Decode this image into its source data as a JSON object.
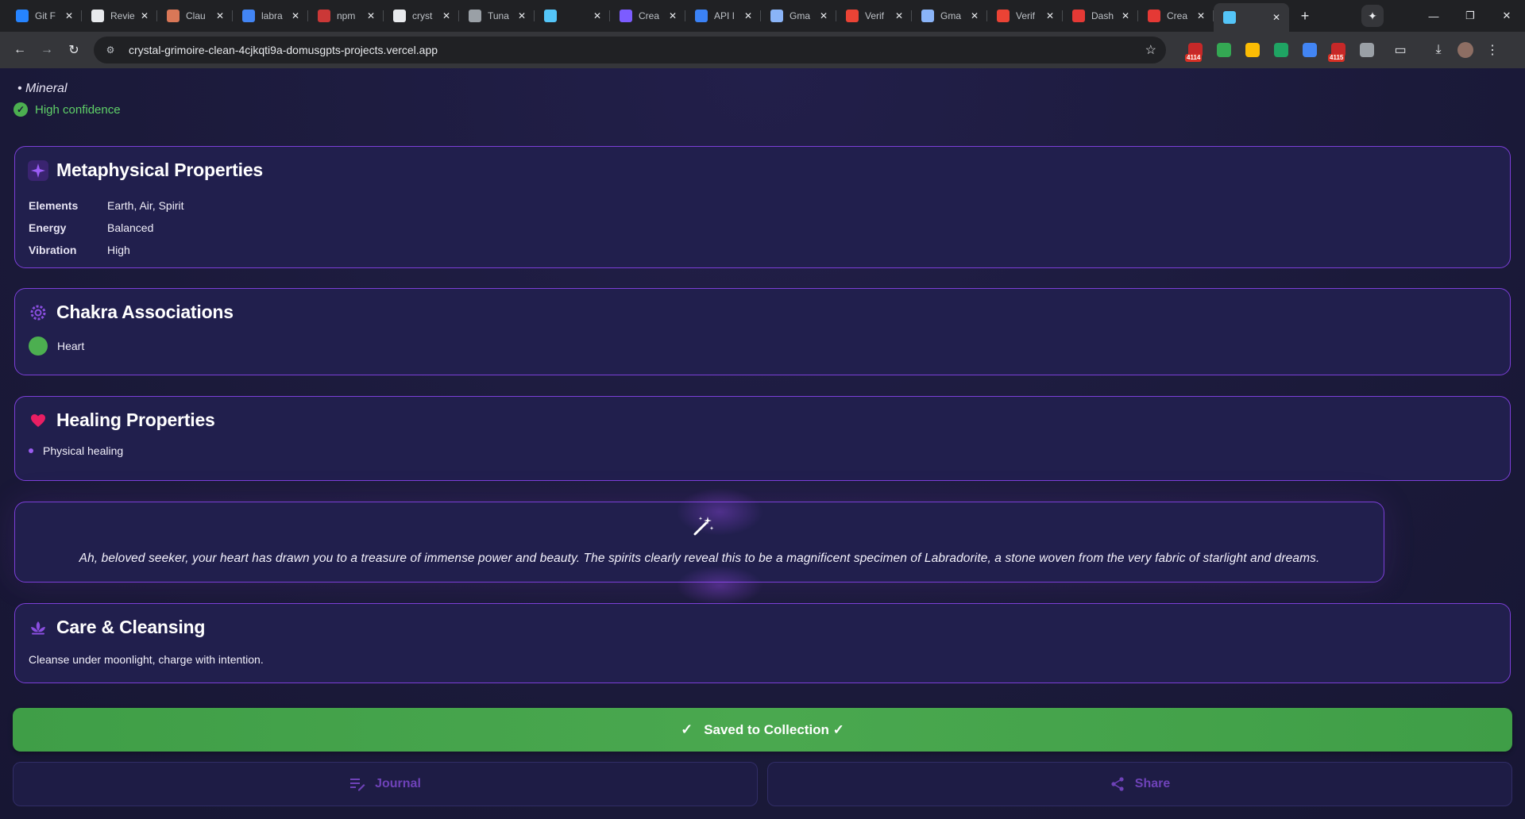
{
  "browser": {
    "tabs": [
      {
        "title": "Git F",
        "icon": "bitbucket-icon",
        "color": "#2684ff"
      },
      {
        "title": "Revie",
        "icon": "github-icon",
        "color": "#e8eaed"
      },
      {
        "title": "Clau",
        "icon": "claude-icon",
        "color": "#d97757"
      },
      {
        "title": "labra",
        "icon": "google-icon",
        "color": "#4285f4"
      },
      {
        "title": "npm",
        "icon": "npm-icon",
        "color": "#cb3837"
      },
      {
        "title": "cryst",
        "icon": "link-icon",
        "color": "#e8eaed"
      },
      {
        "title": "Tuna",
        "icon": "globe-icon",
        "color": "#9aa0a6"
      },
      {
        "title": "",
        "icon": "flutter-icon",
        "color": "#54c5f8"
      },
      {
        "title": "Crea",
        "icon": "obsidian-icon",
        "color": "#7c5cff"
      },
      {
        "title": "API I",
        "icon": "openai-icon",
        "color": "#3b82f6"
      },
      {
        "title": "Gma",
        "icon": "search-icon",
        "color": "#8ab4f8"
      },
      {
        "title": "Verif",
        "icon": "gmail-icon",
        "color": "#ea4335"
      },
      {
        "title": "Gma",
        "icon": "search-icon",
        "color": "#8ab4f8"
      },
      {
        "title": "Verif",
        "icon": "gmail-icon",
        "color": "#ea4335"
      },
      {
        "title": "Dash",
        "icon": "dashboard-icon",
        "color": "#e53935"
      },
      {
        "title": "Crea",
        "icon": "dashboard-icon",
        "color": "#e53935"
      }
    ],
    "active_tab": {
      "title": "",
      "icon": "flutter-icon"
    },
    "new_tab_label": "+",
    "url": "crystal-grimoire-clean-4cjkqti9a-domusgpts-projects.vercel.app",
    "extensions": [
      {
        "name": "adblock-extension-icon",
        "badge": "4114",
        "color": "#c62828"
      },
      {
        "name": "shield-extension-icon",
        "badge": "",
        "color": "#34a853"
      },
      {
        "name": "chrome-extension-icon",
        "badge": "",
        "color": "#fbbc04"
      },
      {
        "name": "drive-extension-icon",
        "badge": "",
        "color": "#1fa463"
      },
      {
        "name": "translate-extension-icon",
        "badge": "",
        "color": "#4285f4"
      },
      {
        "name": "adblock2-extension-icon",
        "badge": "4115",
        "color": "#c62828"
      },
      {
        "name": "puzzle-extension-icon",
        "badge": "",
        "color": "#9aa0a6"
      }
    ]
  },
  "crystal": {
    "type_line": "• Mineral",
    "confidence": "High confidence"
  },
  "metaphysical": {
    "title": "Metaphysical Properties",
    "rows": [
      {
        "label": "Elements",
        "value": "Earth, Air, Spirit"
      },
      {
        "label": "Energy",
        "value": "Balanced"
      },
      {
        "label": "Vibration",
        "value": "High"
      }
    ]
  },
  "chakra": {
    "title": "Chakra Associations",
    "items": [
      {
        "label": "Heart",
        "color": "#4caf50"
      }
    ]
  },
  "healing": {
    "title": "Healing Properties",
    "items": [
      "Physical healing"
    ]
  },
  "oracle": {
    "message": "Ah, beloved seeker, your heart has drawn you to a treasure of immense power and beauty. The spirits clearly reveal this to be a magnificent specimen of Labradorite, a stone woven from the very fabric of starlight and dreams."
  },
  "care": {
    "title": "Care & Cleansing",
    "text": "Cleanse under moonlight, charge with intention."
  },
  "actions": {
    "saved_label": "Saved to Collection ✓",
    "journal_label": "Journal",
    "share_label": "Share"
  },
  "colors": {
    "accent": "#7c3fd8",
    "success": "#4caf50",
    "background": "#1b1a3a"
  }
}
